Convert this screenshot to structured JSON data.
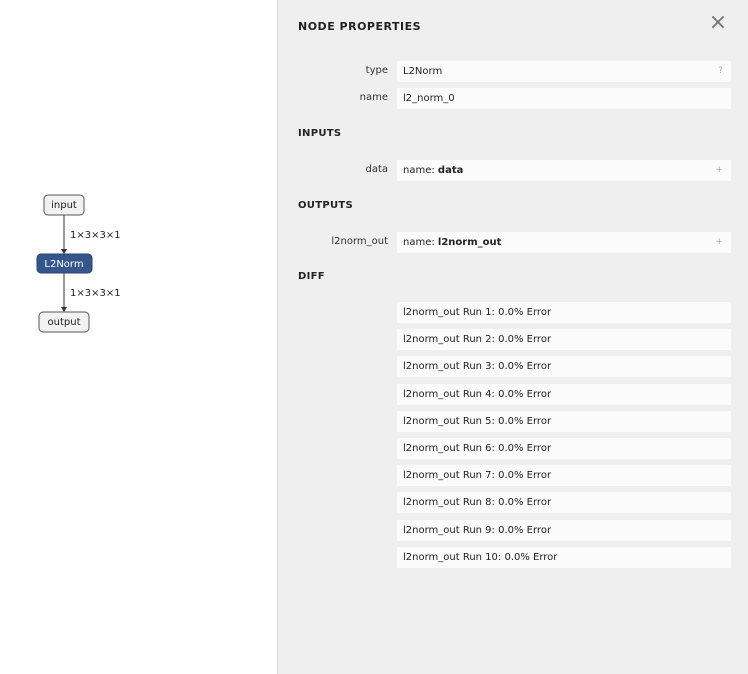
{
  "graph": {
    "nodes": [
      {
        "id": "input",
        "label": "input",
        "selected": false
      },
      {
        "id": "l2norm",
        "label": "L2Norm",
        "selected": true
      },
      {
        "id": "output",
        "label": "output",
        "selected": false
      }
    ],
    "edges": [
      {
        "label": "1×3×3×1"
      },
      {
        "label": "1×3×3×1"
      }
    ]
  },
  "sidebar": {
    "title": "NODE PROPERTIES",
    "close_icon": "×",
    "type_label": "type",
    "type_value": "L2Norm",
    "type_aux": "?",
    "name_label": "name",
    "name_value": "l2_norm_0",
    "inputs_title": "INPUTS",
    "input_label": "data",
    "input_prefix": "name: ",
    "input_value": "data",
    "input_aux": "+",
    "outputs_title": "OUTPUTS",
    "output_label": "l2norm_out",
    "output_prefix": "name: ",
    "output_value": "l2norm_out",
    "output_aux": "+",
    "diff_title": "DIFF",
    "diff": [
      "l2norm_out Run 1: 0.0% Error",
      "l2norm_out Run 2: 0.0% Error",
      "l2norm_out Run 3: 0.0% Error",
      "l2norm_out Run 4: 0.0% Error",
      "l2norm_out Run 5: 0.0% Error",
      "l2norm_out Run 6: 0.0% Error",
      "l2norm_out Run 7: 0.0% Error",
      "l2norm_out Run 8: 0.0% Error",
      "l2norm_out Run 9: 0.0% Error",
      "l2norm_out Run 10: 0.0% Error"
    ]
  },
  "colors": {
    "selected_node": "#34568b",
    "sidebar_bg": "#efefef"
  }
}
